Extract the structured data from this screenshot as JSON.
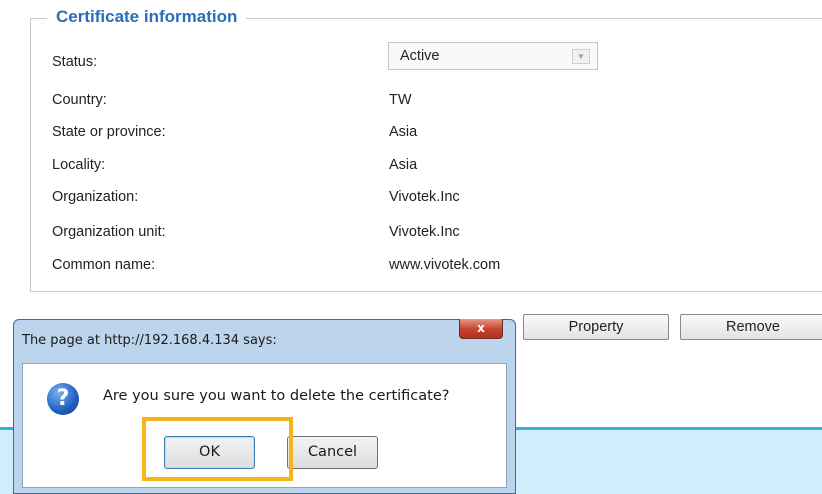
{
  "certificate": {
    "legend": "Certificate information",
    "rows": [
      {
        "label": "Status:",
        "value": "Active"
      },
      {
        "label": "Country:",
        "value": "TW"
      },
      {
        "label": "State or province:",
        "value": "Asia"
      },
      {
        "label": "Locality:",
        "value": "Asia"
      },
      {
        "label": "Organization:",
        "value": "Vivotek.Inc"
      },
      {
        "label": "Organization unit:",
        "value": "Vivotek.Inc"
      },
      {
        "label": "Common name:",
        "value": "www.vivotek.com"
      }
    ]
  },
  "actions": {
    "property": "Property",
    "remove": "Remove"
  },
  "dialog": {
    "title": "The page at http://192.168.4.134 says:",
    "close_glyph": "x",
    "icon_glyph": "?",
    "message": "Are you sure you want to delete the certificate?",
    "ok": "OK",
    "cancel": "Cancel"
  },
  "icons": {
    "question": "question-icon",
    "close": "close-icon",
    "dropdown": "chevron-down-icon"
  },
  "colors": {
    "legend": "#2a6ebb",
    "highlight": "#f4b41a",
    "band": "#cfeefc",
    "band_border": "#33aee7"
  }
}
